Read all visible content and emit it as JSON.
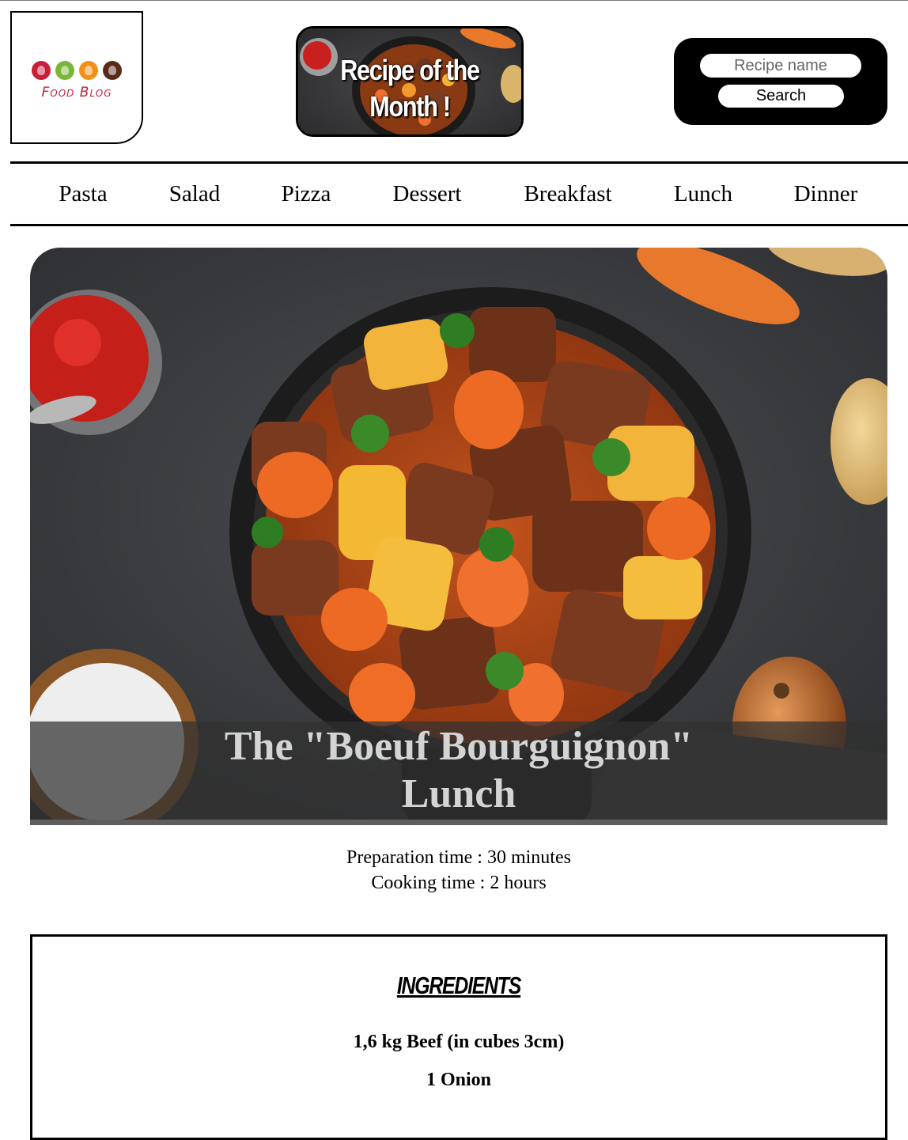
{
  "header": {
    "logo_text": "Food Blog",
    "logo_colors": [
      "#c8203a",
      "#7ab638",
      "#f39018",
      "#5a2a18"
    ],
    "recipe_of_month": "Recipe of the Month !",
    "search": {
      "placeholder": "Recipe name",
      "button_label": "Search"
    }
  },
  "nav": {
    "items": [
      "Pasta",
      "Salad",
      "Pizza",
      "Dessert",
      "Breakfast",
      "Lunch",
      "Dinner"
    ]
  },
  "hero": {
    "title_line1": "The \"Boeuf Bourguignon\"",
    "title_line2": "Lunch"
  },
  "times": {
    "preparation": "Preparation time : 30 minutes",
    "cooking": "Cooking time : 2 hours"
  },
  "ingredients": {
    "title": "INGREDIENTS",
    "items": [
      "1,6 kg Beef (in cubes 3cm)",
      "1 Onion"
    ]
  }
}
